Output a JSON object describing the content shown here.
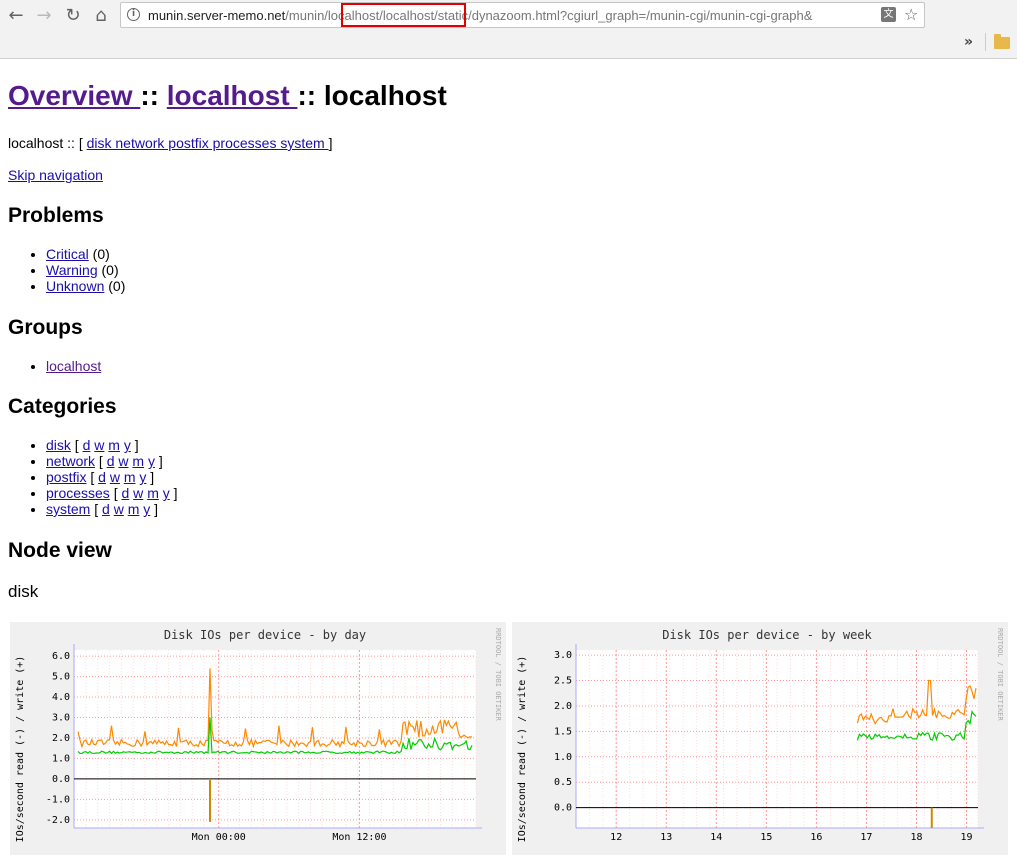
{
  "browser": {
    "url_host": "munin.server-memo.net",
    "url_path_1": "/munin/",
    "url_path_2": "localhost/localhost",
    "url_path_3": "/static/dynazoom.html?cgiurl_graph=/munin-cgi/munin-cgi-graph&",
    "overflow_label": "»",
    "colors": {
      "highlight": "#e00000"
    },
    "icons": {
      "back": "arrow-left-icon",
      "forward": "arrow-right-icon",
      "reload": "reload-icon",
      "home": "home-icon",
      "info": "info-icon",
      "translate": "translate-icon",
      "star": "star-icon",
      "folder": "folder-icon"
    }
  },
  "header": {
    "link_overview": "Overview ",
    "sep1": " :: ",
    "link_localhost": "localhost ",
    "sep2": ":: ",
    "current": "localhost"
  },
  "crumb": {
    "prefix": "localhost :: [ ",
    "link": "disk network postfix processes system ",
    "suffix": "]"
  },
  "skip_nav": "Skip navigation",
  "problems": {
    "title": "Problems",
    "items": [
      {
        "label": "Critical",
        "count": " (0)"
      },
      {
        "label": "Warning",
        "count": " (0)"
      },
      {
        "label": "Unknown",
        "count": " (0)"
      }
    ]
  },
  "groups": {
    "title": "Groups",
    "items": [
      "localhost"
    ]
  },
  "categories": {
    "title": "Categories",
    "open": " [ ",
    "close": " ]",
    "periods": [
      "d",
      "w",
      "m",
      "y"
    ],
    "items": [
      "disk",
      "network",
      "postfix",
      "processes",
      "system"
    ]
  },
  "node_view": {
    "title": "Node view",
    "section": "disk"
  },
  "graphs": {
    "side_label": "RRDTOOL / TOBI OETIKER",
    "colors": {
      "read": "#00cc00",
      "write": "#ff8800",
      "grid": "#ff9999",
      "axis": "#000000"
    },
    "chart_data": [
      {
        "type": "line",
        "title": "Disk IOs per device - by day",
        "ylabel": "IOs/second read (-) / write (+)",
        "yticks": [
          "6.0",
          "5.0",
          "4.0",
          "3.0",
          "2.0",
          "1.0",
          "0.0",
          "-1.0",
          "-2.0"
        ],
        "ylim": [
          -2.4,
          6.3
        ],
        "xticks": [
          "Mon 00:00",
          "Mon 12:00"
        ],
        "grid": true
      },
      {
        "type": "line",
        "title": "Disk IOs per device - by week",
        "ylabel": "IOs/second read (-) / write (+)",
        "yticks": [
          "3.0",
          "2.5",
          "2.0",
          "1.5",
          "1.0",
          "0.5",
          "0.0"
        ],
        "ylim": [
          -0.4,
          3.1
        ],
        "xticks": [
          "12",
          "13",
          "14",
          "15",
          "16",
          "17",
          "18",
          "19"
        ],
        "grid": true
      }
    ]
  }
}
